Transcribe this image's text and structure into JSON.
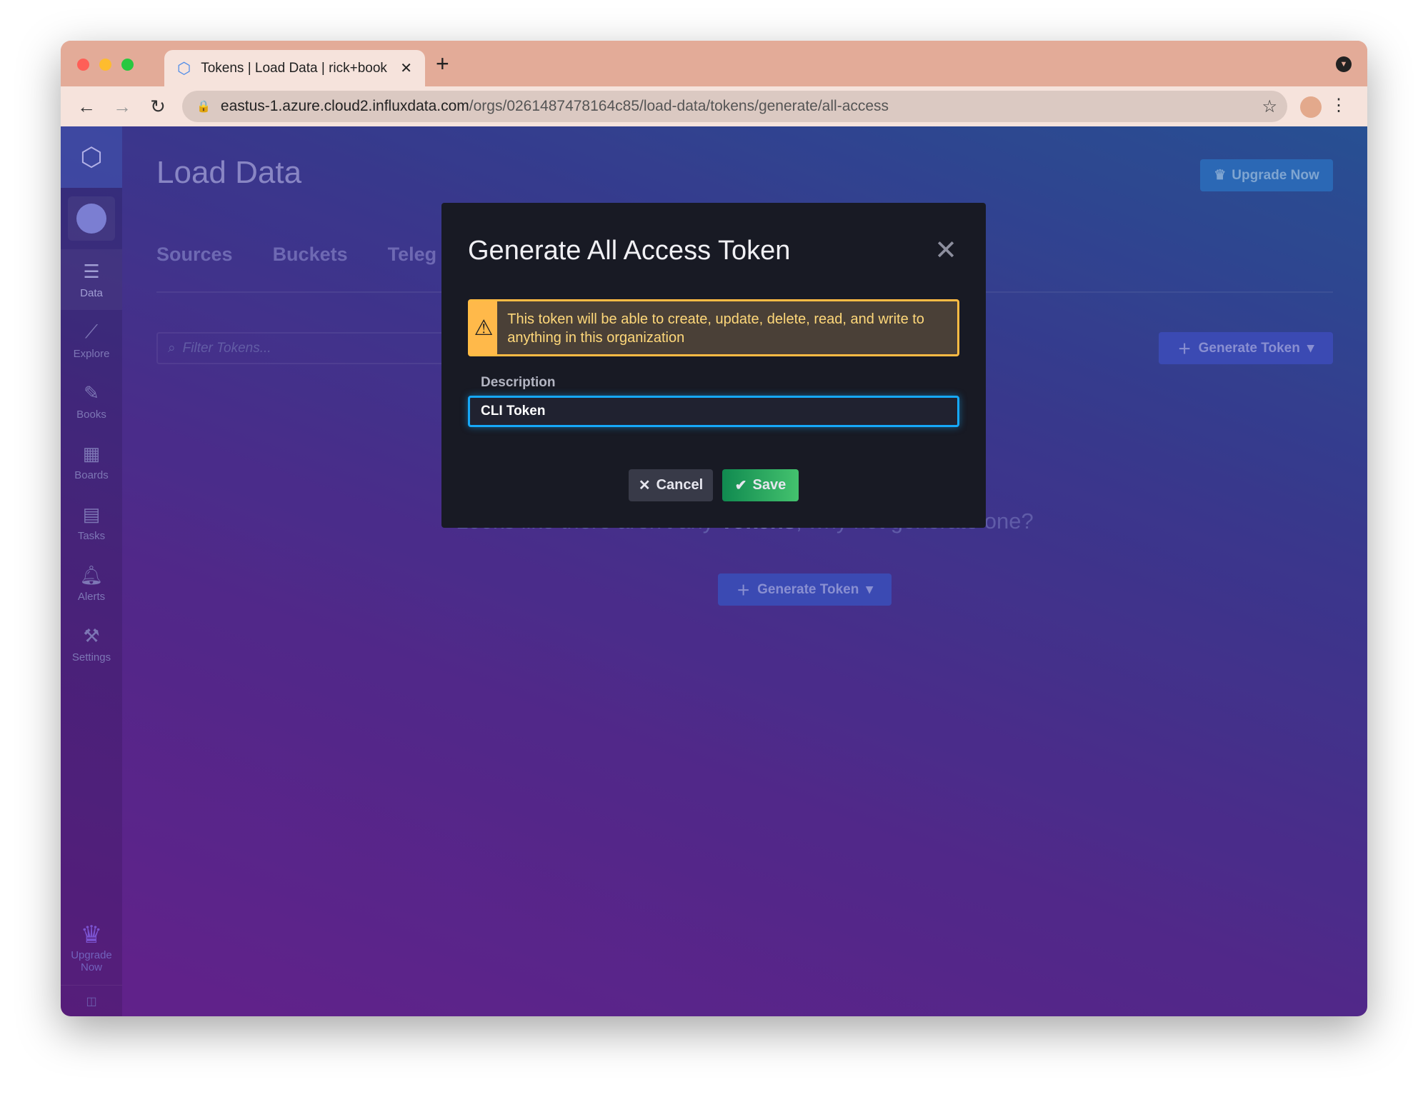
{
  "browser": {
    "tab_title": "Tokens | Load Data | rick+book",
    "url_host": "eastus-1.azure.cloud2.influxdata.com",
    "url_path": "/orgs/0261487478164c85/load-data/tokens/generate/all-access"
  },
  "sidebar": {
    "items": [
      {
        "label": "Data",
        "icon": "database-icon"
      },
      {
        "label": "Explore",
        "icon": "graph-icon"
      },
      {
        "label": "Books",
        "icon": "notebook-icon"
      },
      {
        "label": "Boards",
        "icon": "dashboard-icon"
      },
      {
        "label": "Tasks",
        "icon": "calendar-icon"
      },
      {
        "label": "Alerts",
        "icon": "bell-icon"
      },
      {
        "label": "Settings",
        "icon": "wrench-icon"
      }
    ],
    "upgrade_line1": "Upgrade",
    "upgrade_line2": "Now"
  },
  "page": {
    "title": "Load Data",
    "upgrade_button": "Upgrade Now",
    "tabs": [
      "Sources",
      "Buckets",
      "Teleg"
    ],
    "filter_placeholder": "Filter Tokens...",
    "generate_token": "Generate Token",
    "empty_pre": "Looks like there aren't any ",
    "empty_bold": "Tokens",
    "empty_post": ", why not generate one?"
  },
  "modal": {
    "title": "Generate All Access Token",
    "warning": "This token will be able to create, update, delete, read, and write to anything in this organization",
    "description_label": "Description",
    "description_value": "CLI Token",
    "cancel": "Cancel",
    "save": "Save"
  },
  "colors": {
    "accent": "#16a8f8",
    "warning": "#ffbb44",
    "save": "#34b060"
  }
}
